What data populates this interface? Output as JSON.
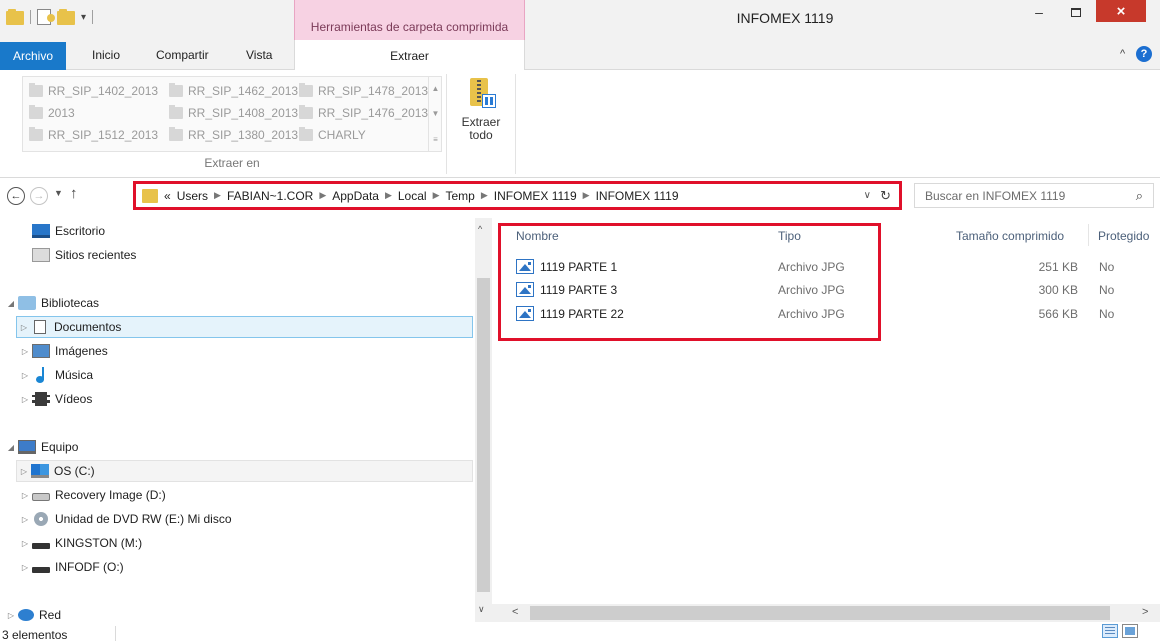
{
  "window": {
    "title": "INFOMEX 1119",
    "context_tab": "Herramientas de carpeta comprimida",
    "minimize": "–",
    "close": "×"
  },
  "ribbon": {
    "tabs": [
      "Archivo",
      "Inicio",
      "Compartir",
      "Vista",
      "Extraer"
    ],
    "minimize_glyph": "^",
    "help_glyph": "?",
    "destinations": [
      [
        "RR_SIP_1402_2013",
        "RR_SIP_1462_2013",
        "RR_SIP_1478_2013"
      ],
      [
        "2013",
        "RR_SIP_1408_2013",
        "RR_SIP_1476_2013"
      ],
      [
        "RR_SIP_1512_2013",
        "RR_SIP_1380_2013",
        "CHARLY"
      ]
    ],
    "group_label": "Extraer en",
    "extract_all_label_1": "Extraer",
    "extract_all_label_2": "todo"
  },
  "address": {
    "overflow": "«",
    "crumbs": [
      "Users",
      "FABIAN~1.COR",
      "AppData",
      "Local",
      "Temp",
      "INFOMEX 1119",
      "INFOMEX 1119"
    ],
    "search_placeholder": "Buscar en INFOMEX 1119"
  },
  "nav_pane": {
    "favorites": [
      "Escritorio",
      "Sitios recientes"
    ],
    "libraries": "Bibliotecas",
    "library_items": [
      "Documentos",
      "Imágenes",
      "Música",
      "Vídeos"
    ],
    "computer": "Equipo",
    "drives": [
      "OS (C:)",
      "Recovery Image (D:)",
      "Unidad de DVD RW (E:) Mi disco",
      "KINGSTON (M:)",
      "INFODF (O:)"
    ],
    "network": "Red"
  },
  "file_list": {
    "columns": [
      "Nombre",
      "Tipo",
      "Tamaño comprimido",
      "Protegido"
    ],
    "rows": [
      {
        "name": "1119 PARTE 1",
        "type": "Archivo JPG",
        "size": "251 KB",
        "protected": "No"
      },
      {
        "name": "1119 PARTE 3",
        "type": "Archivo JPG",
        "size": "300 KB",
        "protected": "No"
      },
      {
        "name": "1119 PARTE 22",
        "type": "Archivo JPG",
        "size": "566 KB",
        "protected": "No"
      }
    ]
  },
  "status": {
    "count": "3 elementos"
  },
  "colors": {
    "highlight_red": "#e0102a",
    "accent_blue": "#1979ca",
    "context_pink": "#f7d2e3",
    "folder_yellow": "#e8c24a"
  }
}
